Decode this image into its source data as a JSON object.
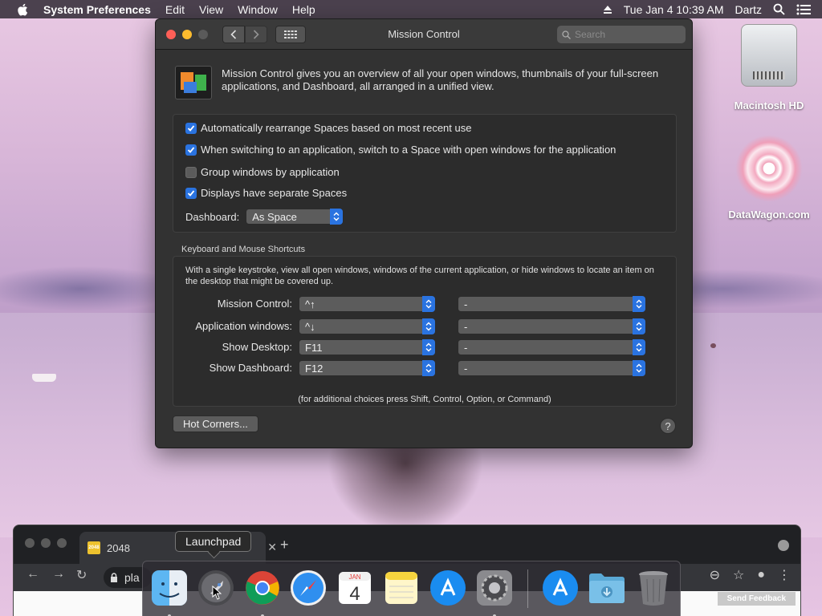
{
  "menubar": {
    "app_name": "System Preferences",
    "menus": [
      "Edit",
      "View",
      "Window",
      "Help"
    ],
    "clock": "Tue Jan 4  10:39 AM",
    "user": "Dartz"
  },
  "desktop": {
    "icons": [
      {
        "label": "Macintosh HD"
      },
      {
        "label": "DataWagon.com"
      }
    ]
  },
  "window": {
    "title": "Mission Control",
    "search_placeholder": "Search",
    "intro": "Mission Control gives you an overview of all your open windows, thumbnails of your full-screen applications, and Dashboard, all arranged in a unified view.",
    "options": [
      {
        "label": "Automatically rearrange Spaces based on most recent use",
        "checked": true
      },
      {
        "label": "When switching to an application, switch to a Space with open windows for the application",
        "checked": true
      },
      {
        "label": "Group windows by application",
        "checked": false
      },
      {
        "label": "Displays have separate Spaces",
        "checked": true
      }
    ],
    "dashboard_label": "Dashboard:",
    "dashboard_value": "As Space",
    "kb_section_title": "Keyboard and Mouse Shortcuts",
    "kb_description": "With a single keystroke, view all open windows, windows of the current application, or hide windows to locate an item on the desktop that might be covered up.",
    "shortcuts": [
      {
        "label": "Mission Control:",
        "key": "^↑",
        "mouse": "-"
      },
      {
        "label": "Application windows:",
        "key": "^↓",
        "mouse": "-"
      },
      {
        "label": "Show Desktop:",
        "key": "F11",
        "mouse": "-"
      },
      {
        "label": "Show Dashboard:",
        "key": "F12",
        "mouse": "-"
      }
    ],
    "kb_hint": "(for additional choices press Shift, Control, Option, or Command)",
    "hot_corners_label": "Hot Corners...",
    "help_label": "?"
  },
  "browser": {
    "tab_title": "2048",
    "favicon_text": "2048",
    "url_partial": "pla",
    "feedback_label": "Send Feedback"
  },
  "dock": {
    "tooltip": "Launchpad",
    "calendar_month": "JAN",
    "calendar_day": "4",
    "apps": [
      "Finder",
      "Launchpad",
      "Chrome",
      "Safari",
      "Calendar",
      "Notes",
      "App Store",
      "System Preferences",
      "App Store",
      "Downloads",
      "Trash"
    ]
  },
  "colors": {
    "accent": "#2a73e0",
    "window_bg": "#323232"
  }
}
